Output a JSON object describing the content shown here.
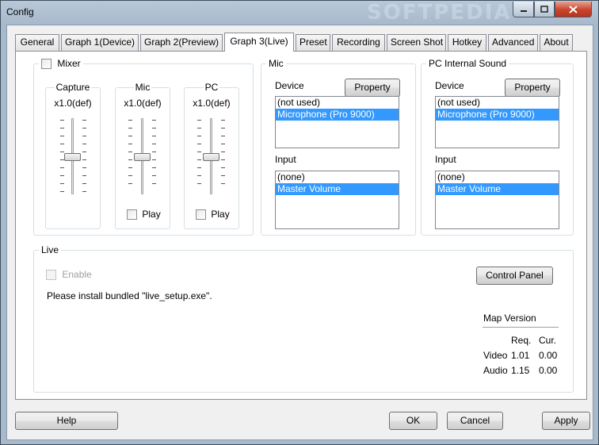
{
  "window": {
    "title": "Config",
    "watermark": "SOFTPEDIA"
  },
  "tabs": [
    {
      "label": "General"
    },
    {
      "label": "Graph 1(Device)"
    },
    {
      "label": "Graph 2(Preview)"
    },
    {
      "label": "Graph 3(Live)"
    },
    {
      "label": "Preset"
    },
    {
      "label": "Recording"
    },
    {
      "label": "Screen Shot"
    },
    {
      "label": "Hotkey"
    },
    {
      "label": "Advanced"
    },
    {
      "label": "About"
    }
  ],
  "active_tab": "Graph 3(Live)",
  "mixer": {
    "label": "Mixer",
    "checked": false,
    "sliders": [
      {
        "title": "Capture",
        "value": "x1.0(def)",
        "level": 0.5
      },
      {
        "title": "Mic",
        "value": "x1.0(def)",
        "level": 0.5,
        "play_label": "Play"
      },
      {
        "title": "PC",
        "value": "x1.0(def)",
        "level": 0.5,
        "play_label": "Play"
      }
    ]
  },
  "mic": {
    "title": "Mic",
    "device_label": "Device",
    "property_label": "Property",
    "devices": [
      "(not used)",
      "Microphone (Pro 9000)"
    ],
    "selected_device": 1,
    "input_label": "Input",
    "inputs": [
      "(none)",
      "Master Volume"
    ],
    "selected_input": 1
  },
  "pc_sound": {
    "title": "PC Internal Sound",
    "device_label": "Device",
    "property_label": "Property",
    "devices": [
      "(not used)",
      "Microphone (Pro 9000)"
    ],
    "selected_device": 1,
    "input_label": "Input",
    "inputs": [
      "(none)",
      "Master Volume"
    ],
    "selected_input": 1
  },
  "live": {
    "title": "Live",
    "enable_label": "Enable",
    "message": "Please install bundled \"live_setup.exe\".",
    "control_panel_label": "Control Panel",
    "map_version": {
      "title": "Map Version",
      "col_req": "Req.",
      "col_cur": "Cur.",
      "rows": [
        {
          "name": "Video",
          "req": "1.01",
          "cur": "0.00"
        },
        {
          "name": "Audio",
          "req": "1.15",
          "cur": "0.00"
        }
      ]
    }
  },
  "footer": {
    "help": "Help",
    "ok": "OK",
    "cancel": "Cancel",
    "apply": "Apply"
  }
}
